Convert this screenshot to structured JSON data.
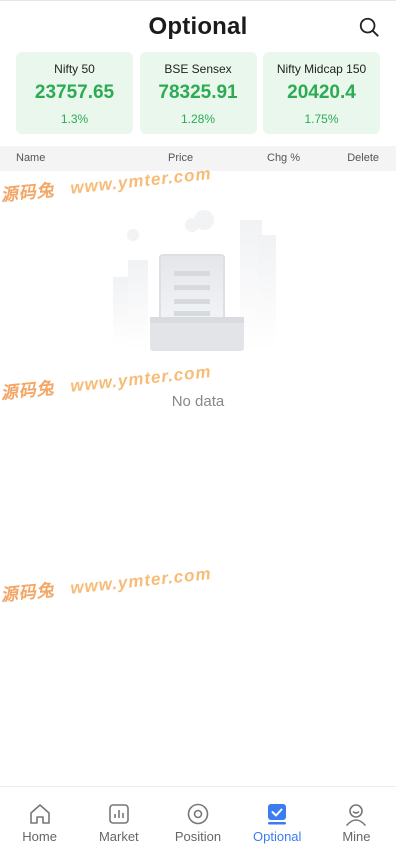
{
  "header": {
    "title": "Optional",
    "search_icon": "search-icon"
  },
  "indices": [
    {
      "name": "Nifty 50",
      "price": "23757.65",
      "change": "1.3%"
    },
    {
      "name": "BSE Sensex",
      "price": "78325.91",
      "change": "1.28%"
    },
    {
      "name": "Nifty Midcap 150",
      "price": "20420.4",
      "change": "1.75%"
    }
  ],
  "columns": {
    "name": "Name",
    "price": "Price",
    "change": "Chg %",
    "delete": "Delete"
  },
  "empty_state": {
    "label": "No data",
    "icon": "empty-document-icon"
  },
  "watermark": {
    "cn": "源码兔",
    "url": "www.ymter.com"
  },
  "tabbar": {
    "active": "optional",
    "active_color": "#3b7cf0",
    "items": [
      {
        "label": "Home",
        "icon": "home-icon"
      },
      {
        "label": "Market",
        "icon": "market-icon"
      },
      {
        "label": "Position",
        "icon": "position-icon"
      },
      {
        "label": "Optional",
        "icon": "optional-icon"
      },
      {
        "label": "Mine",
        "icon": "mine-icon"
      }
    ]
  },
  "colors": {
    "up": "#2dab53",
    "card_bg": "#e9f7ec"
  }
}
